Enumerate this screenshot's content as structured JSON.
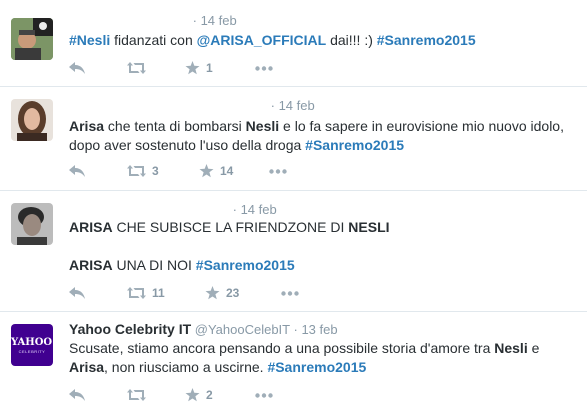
{
  "tweets": [
    {
      "time": "· 14 feb",
      "text_parts": [
        {
          "t": "#Nesli",
          "c": "hashtag"
        },
        {
          "t": " fidanzati con ",
          "c": ""
        },
        {
          "t": "@ARISA_OFFICIAL",
          "c": "mention"
        },
        {
          "t": " dai!!! :) ",
          "c": ""
        },
        {
          "t": "#Sanremo2015",
          "c": "hashtag"
        }
      ],
      "retweets": "",
      "favorites": "1"
    },
    {
      "time": "· 14 feb",
      "text_parts": [
        {
          "t": "Arisa",
          "c": "b"
        },
        {
          "t": " che tenta di bombarsi ",
          "c": ""
        },
        {
          "t": "Nesli",
          "c": "b"
        },
        {
          "t": " e lo fa sapere in eurovisione mio nuovo idolo, dopo aver sostenuto l'uso della droga ",
          "c": ""
        },
        {
          "t": "#Sanremo2015",
          "c": "hashtag"
        }
      ],
      "retweets": "3",
      "favorites": "14"
    },
    {
      "time": "· 14 feb",
      "text_parts": [
        {
          "t": "ARISA",
          "c": "b"
        },
        {
          "t": " CHE SUBISCE LA FRIENDZONE DI ",
          "c": ""
        },
        {
          "t": "NESLI",
          "c": "b"
        },
        {
          "t": "\n\n",
          "c": ""
        },
        {
          "t": "ARISA",
          "c": "b"
        },
        {
          "t": " UNA DI NOI ",
          "c": ""
        },
        {
          "t": "#Sanremo2015",
          "c": "hashtag"
        }
      ],
      "retweets": "11",
      "favorites": "23"
    },
    {
      "name": "Yahoo Celebrity IT",
      "handle": "@YahooCelebIT",
      "time": "· 13 feb",
      "avatar_label": "YAHOO!",
      "avatar_sub": "CELEBRITY",
      "text_parts": [
        {
          "t": "Scusate, stiamo ancora pensando a una possibile storia d'amore tra ",
          "c": ""
        },
        {
          "t": "Nesli",
          "c": "b"
        },
        {
          "t": " e ",
          "c": ""
        },
        {
          "t": "Arisa",
          "c": "b"
        },
        {
          "t": ", non riusciamo a uscirne. ",
          "c": ""
        },
        {
          "t": "#Sanremo2015",
          "c": "hashtag"
        }
      ],
      "retweets": "",
      "favorites": "2"
    }
  ],
  "colors": {
    "link": "#2b7bb9",
    "muted": "#8899a6",
    "yahoo": "#400090"
  }
}
